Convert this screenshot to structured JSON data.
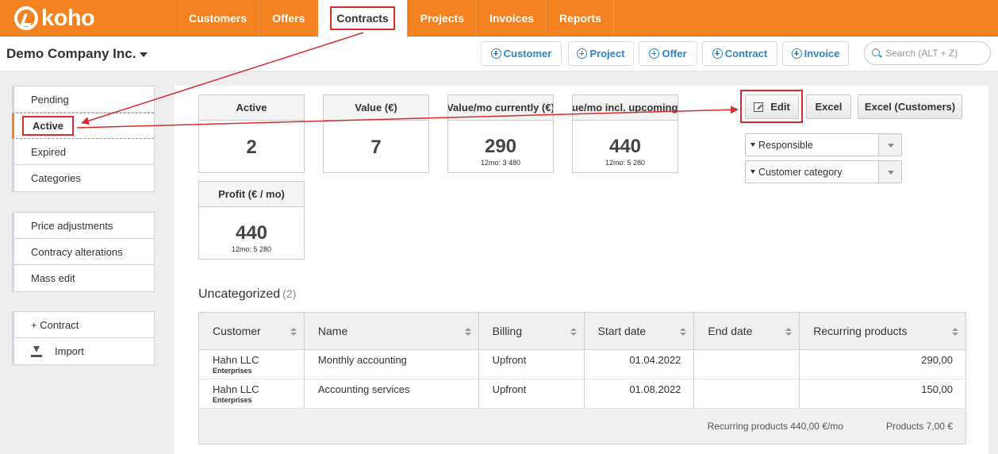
{
  "app": {
    "logo_text": "koho"
  },
  "nav": {
    "items": [
      {
        "label": "Customers",
        "active": false
      },
      {
        "label": "Offers",
        "active": false
      },
      {
        "label": "Contracts",
        "active": true
      },
      {
        "label": "Projects",
        "active": false
      },
      {
        "label": "Invoices",
        "active": false
      },
      {
        "label": "Reports",
        "active": false
      }
    ]
  },
  "subbar": {
    "company": "Demo Company Inc.",
    "quick_add": [
      {
        "label": "Customer"
      },
      {
        "label": "Project"
      },
      {
        "label": "Offer"
      },
      {
        "label": "Contract"
      },
      {
        "label": "Invoice"
      }
    ],
    "search_placeholder": "Search (ALT + Z)"
  },
  "sidebar": {
    "status": [
      {
        "label": "Pending"
      },
      {
        "label": "Active",
        "active": true
      },
      {
        "label": "Expired"
      },
      {
        "label": "Categories"
      }
    ],
    "tools": [
      {
        "label": "Price adjustments"
      },
      {
        "label": "Contracy alterations"
      },
      {
        "label": "Mass edit"
      }
    ],
    "actions": [
      {
        "label": "+ Contract"
      },
      {
        "label": "Import"
      }
    ]
  },
  "stats": [
    {
      "title": "Active",
      "value": "2",
      "sub": ""
    },
    {
      "title": "Value (€)",
      "value": "7",
      "sub": ""
    },
    {
      "title": "Value/mo currently (€)",
      "value": "290",
      "sub": "12mo: 3 480"
    },
    {
      "title": "Value/mo incl. upcoming (€)",
      "value": "440",
      "sub": "12mo: 5 280"
    },
    {
      "title": "Profit (€ / mo)",
      "value": "440",
      "sub": "12mo: 5 280"
    }
  ],
  "toolbar": {
    "edit_label": "Edit",
    "excel_label": "Excel",
    "excel_customers_label": "Excel (Customers)"
  },
  "filters": {
    "responsible": "Responsible",
    "customer_category": "Customer category"
  },
  "section": {
    "title": "Uncategorized",
    "count": "(2)"
  },
  "table": {
    "columns": [
      "Customer",
      "Name",
      "Billing",
      "Start date",
      "End date",
      "Recurring products"
    ],
    "rows": [
      {
        "customer": "Hahn LLC",
        "category": "Enterprises",
        "name": "Monthly accounting",
        "billing": "Upfront",
        "start": "01.04.2022",
        "end": "",
        "recurring": "290,00"
      },
      {
        "customer": "Hahn LLC",
        "category": "Enterprises",
        "name": "Accounting services",
        "billing": "Upfront",
        "start": "01.08.2022",
        "end": "",
        "recurring": "150,00"
      }
    ],
    "footer_recurring": "Recurring products 440,00 €/mo",
    "footer_products": "Products 7,00 €"
  },
  "colors": {
    "brand": "#f58220",
    "link": "#2a87c9",
    "annotation": "#d92b2b"
  }
}
